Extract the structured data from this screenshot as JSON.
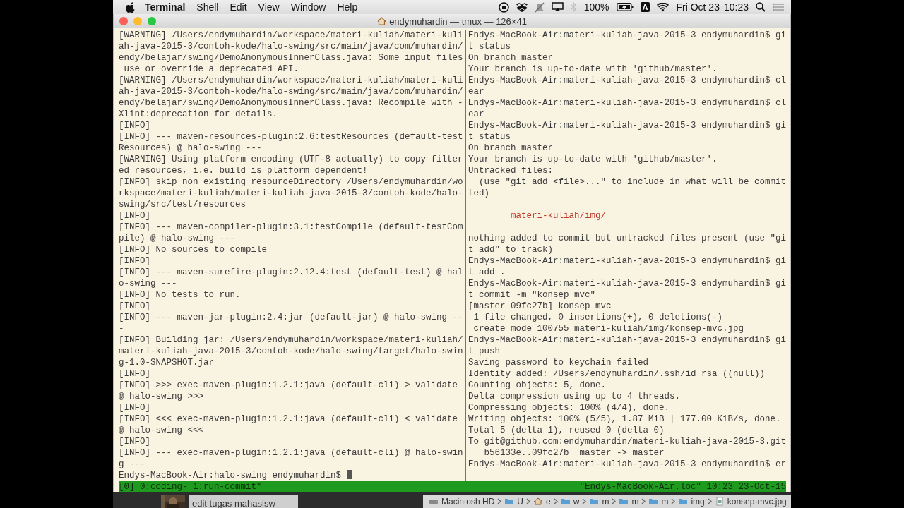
{
  "menu_bar": {
    "app": "Terminal",
    "menus": [
      "Shell",
      "Edit",
      "View",
      "Window",
      "Help"
    ],
    "battery": "100%",
    "input_source": "A",
    "date": "Fri Oct 23",
    "time": "10:23"
  },
  "window": {
    "title": "endymuhardin — tmux — 126×41"
  },
  "panes": [
    {
      "cursor": true,
      "lines": [
        {
          "kind": "text",
          "text": "[WARNING] /Users/endymuhardin/workspace/materi-kuliah/materi-kuli"
        },
        {
          "kind": "text",
          "text": "ah-java-2015-3/contoh-kode/halo-swing/src/main/java/com/muhardin/"
        },
        {
          "kind": "text",
          "text": "endy/belajar/swing/DemoAnonymousInnerClass.java: Some input files"
        },
        {
          "kind": "text",
          "text": " use or override a deprecated API."
        },
        {
          "kind": "text",
          "text": "[WARNING] /Users/endymuhardin/workspace/materi-kuliah/materi-kuli"
        },
        {
          "kind": "text",
          "text": "ah-java-2015-3/contoh-kode/halo-swing/src/main/java/com/muhardin/"
        },
        {
          "kind": "text",
          "text": "endy/belajar/swing/DemoAnonymousInnerClass.java: Recompile with -"
        },
        {
          "kind": "text",
          "text": "Xlint:deprecation for details."
        },
        {
          "kind": "text",
          "text": "[INFO]"
        },
        {
          "kind": "text",
          "text": "[INFO] --- maven-resources-plugin:2.6:testResources (default-test"
        },
        {
          "kind": "text",
          "text": "Resources) @ halo-swing ---"
        },
        {
          "kind": "text",
          "text": "[WARNING] Using platform encoding (UTF-8 actually) to copy filter"
        },
        {
          "kind": "text",
          "text": "ed resources, i.e. build is platform dependent!"
        },
        {
          "kind": "text",
          "text": "[INFO] skip non existing resourceDirectory /Users/endymuhardin/wo"
        },
        {
          "kind": "text",
          "text": "rkspace/materi-kuliah/materi-kuliah-java-2015-3/contoh-kode/halo-"
        },
        {
          "kind": "text",
          "text": "swing/src/test/resources"
        },
        {
          "kind": "text",
          "text": "[INFO]"
        },
        {
          "kind": "text",
          "text": "[INFO] --- maven-compiler-plugin:3.1:testCompile (default-testCom"
        },
        {
          "kind": "text",
          "text": "pile) @ halo-swing ---"
        },
        {
          "kind": "text",
          "text": "[INFO] No sources to compile"
        },
        {
          "kind": "text",
          "text": "[INFO]"
        },
        {
          "kind": "text",
          "text": "[INFO] --- maven-surefire-plugin:2.12.4:test (default-test) @ hal"
        },
        {
          "kind": "text",
          "text": "o-swing ---"
        },
        {
          "kind": "text",
          "text": "[INFO] No tests to run."
        },
        {
          "kind": "text",
          "text": "[INFO]"
        },
        {
          "kind": "text",
          "text": "[INFO] --- maven-jar-plugin:2.4:jar (default-jar) @ halo-swing --"
        },
        {
          "kind": "text",
          "text": "-"
        },
        {
          "kind": "text",
          "text": "[INFO] Building jar: /Users/endymuhardin/workspace/materi-kuliah/"
        },
        {
          "kind": "text",
          "text": "materi-kuliah-java-2015-3/contoh-kode/halo-swing/target/halo-swin"
        },
        {
          "kind": "text",
          "text": "g-1.0-SNAPSHOT.jar"
        },
        {
          "kind": "text",
          "text": "[INFO]"
        },
        {
          "kind": "text",
          "text": "[INFO] >>> exec-maven-plugin:1.2.1:java (default-cli) > validate"
        },
        {
          "kind": "text",
          "text": "@ halo-swing >>>"
        },
        {
          "kind": "text",
          "text": "[INFO]"
        },
        {
          "kind": "text",
          "text": "[INFO] <<< exec-maven-plugin:1.2.1:java (default-cli) < validate"
        },
        {
          "kind": "text",
          "text": "@ halo-swing <<<"
        },
        {
          "kind": "text",
          "text": "[INFO]"
        },
        {
          "kind": "text",
          "text": "[INFO] --- exec-maven-plugin:1.2.1:java (default-cli) @ halo-swin"
        },
        {
          "kind": "text",
          "text": "g ---"
        },
        {
          "kind": "text",
          "text": "Endys-MacBook-Air:halo-swing endymuhardin$"
        }
      ]
    },
    {
      "cursor": false,
      "lines": [
        {
          "kind": "text",
          "text": "Endys-MacBook-Air:materi-kuliah-java-2015-3 endymuhardin$ gi"
        },
        {
          "kind": "text",
          "text": "t status"
        },
        {
          "kind": "text",
          "text": "On branch master"
        },
        {
          "kind": "text",
          "text": "Your branch is up-to-date with 'github/master'."
        },
        {
          "kind": "text",
          "text": "Endys-MacBook-Air:materi-kuliah-java-2015-3 endymuhardin$ cl"
        },
        {
          "kind": "text",
          "text": "ear"
        },
        {
          "kind": "text",
          "text": "Endys-MacBook-Air:materi-kuliah-java-2015-3 endymuhardin$ cl"
        },
        {
          "kind": "text",
          "text": "ear"
        },
        {
          "kind": "text",
          "text": "Endys-MacBook-Air:materi-kuliah-java-2015-3 endymuhardin$ gi"
        },
        {
          "kind": "text",
          "text": "t status"
        },
        {
          "kind": "text",
          "text": "On branch master"
        },
        {
          "kind": "text",
          "text": "Your branch is up-to-date with 'github/master'."
        },
        {
          "kind": "text",
          "text": "Untracked files:"
        },
        {
          "kind": "text",
          "text": "  (use \"git add <file>...\" to include in what will be commit"
        },
        {
          "kind": "text",
          "text": "ted)"
        },
        {
          "kind": "blank"
        },
        {
          "kind": "untracked",
          "text": "        materi-kuliah/img/"
        },
        {
          "kind": "blank"
        },
        {
          "kind": "text",
          "text": "nothing added to commit but untracked files present (use \"gi"
        },
        {
          "kind": "text",
          "text": "t add\" to track)"
        },
        {
          "kind": "text",
          "text": "Endys-MacBook-Air:materi-kuliah-java-2015-3 endymuhardin$ gi"
        },
        {
          "kind": "text",
          "text": "t add ."
        },
        {
          "kind": "text",
          "text": "Endys-MacBook-Air:materi-kuliah-java-2015-3 endymuhardin$ gi"
        },
        {
          "kind": "text",
          "text": "t commit -m \"konsep mvc\""
        },
        {
          "kind": "text",
          "text": "[master 09fc27b] konsep mvc"
        },
        {
          "kind": "text",
          "text": " 1 file changed, 0 insertions(+), 0 deletions(-)"
        },
        {
          "kind": "text",
          "text": " create mode 100755 materi-kuliah/img/konsep-mvc.jpg"
        },
        {
          "kind": "text",
          "text": "Endys-MacBook-Air:materi-kuliah-java-2015-3 endymuhardin$ gi"
        },
        {
          "kind": "text",
          "text": "t push"
        },
        {
          "kind": "text",
          "text": "Saving password to keychain failed"
        },
        {
          "kind": "text",
          "text": "Identity added: /Users/endymuhardin/.ssh/id_rsa ((null))"
        },
        {
          "kind": "text",
          "text": "Counting objects: 5, done."
        },
        {
          "kind": "text",
          "text": "Delta compression using up to 4 threads."
        },
        {
          "kind": "text",
          "text": "Compressing objects: 100% (4/4), done."
        },
        {
          "kind": "text",
          "text": "Writing objects: 100% (5/5), 1.87 MiB | 177.00 KiB/s, done."
        },
        {
          "kind": "text",
          "text": "Total 5 (delta 1), reused 0 (delta 0)"
        },
        {
          "kind": "text",
          "text": "To git@github.com:endymuhardin/materi-kuliah-java-2015-3.git"
        },
        {
          "kind": "text",
          "text": "   b56133e..09fc27b  master -> master"
        },
        {
          "kind": "text",
          "text": "Endys-MacBook-Air:materi-kuliah-java-2015-3 endymuhardin$ er"
        }
      ]
    }
  ],
  "tmux_status": {
    "windows": "[0] 0:coding- 1:run-commit*",
    "host_clock": "\"Endys-MacBook-Air.loc\" 10:23 23-Oct-15"
  },
  "background": {
    "task_title": "edit tugas mahasisw",
    "path": [
      {
        "kind": "disk",
        "label": "Macintosh HD"
      },
      {
        "kind": "folder",
        "label": "U"
      },
      {
        "kind": "home",
        "label": "e"
      },
      {
        "kind": "folder",
        "label": "w"
      },
      {
        "kind": "folder",
        "label": "m"
      },
      {
        "kind": "folder",
        "label": "m"
      },
      {
        "kind": "folder",
        "label": "m"
      },
      {
        "kind": "folder",
        "label": "img"
      },
      {
        "kind": "file",
        "label": "konsep-mvc.jpg"
      }
    ]
  }
}
